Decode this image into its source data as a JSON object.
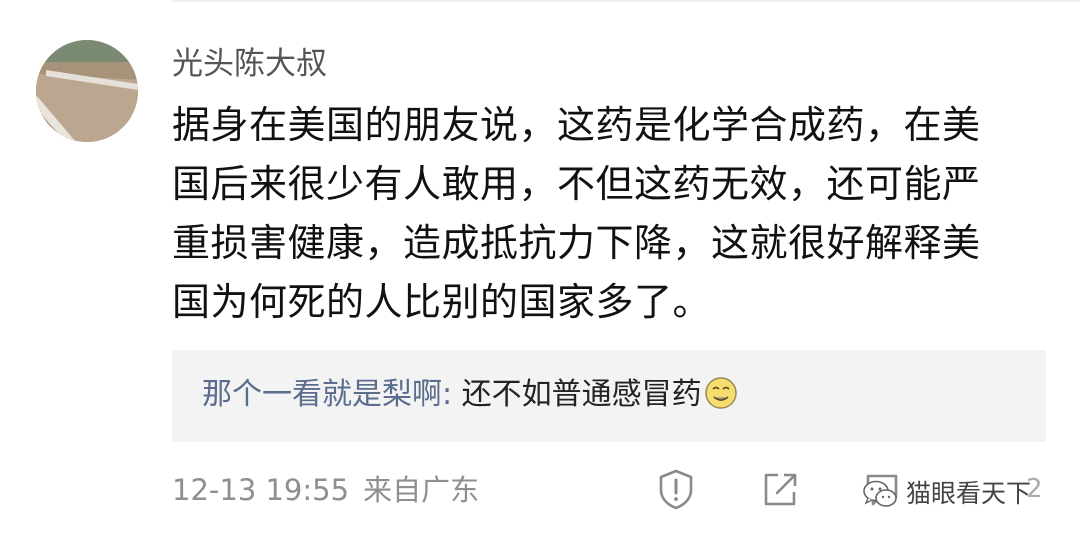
{
  "comment": {
    "username": "光头陈大叔",
    "text_lines": [
      "据身在美国的朋友说，这药是化学合成药，在美",
      "国后来很少有人敢用，不但这药无效，还可能严",
      "重损害健康，造成抵抗力下降，这就很好解释美",
      "国为何死的人比别的国家多了。"
    ],
    "timestamp": "12-13 19:55",
    "source": "来自广东"
  },
  "reply": {
    "author": "那个一看就是梨啊",
    "separator": ": ",
    "text": "还不如普通感冒药",
    "emoji": "smirk-emoji"
  },
  "actions": {
    "report_icon": "report-icon",
    "share_icon": "share-icon",
    "comment_icon": "comment-icon",
    "like_count": "2"
  },
  "watermark": {
    "text": "猫眼看天下",
    "icon": "wechat-icon"
  },
  "colors": {
    "username": "#555555",
    "body_text": "#111111",
    "reply_author": "#5a6d8d",
    "reply_bg": "#f3f3f3",
    "meta": "#8f8f8f"
  }
}
